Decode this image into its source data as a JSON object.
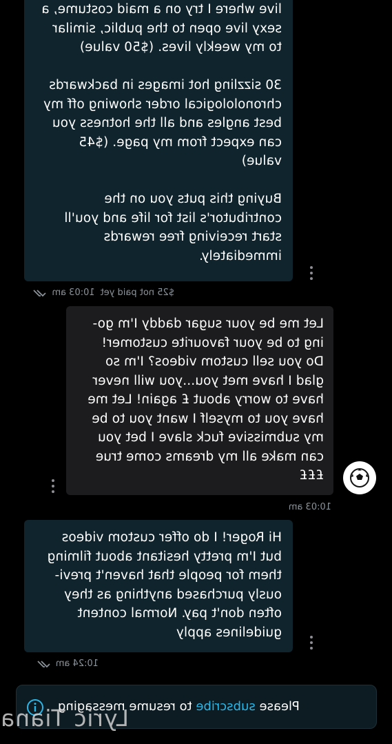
{
  "messages": [
    {
      "paragraphs": [
        "live where I try on a maid costume, a\nsexy live open to the public, similar\nto my weekly lives. ($50 value)",
        "30 sizzling hot images in backwards\nchronolological order showing off my\nbest angles and all the hotness you\ncan expect from my page. ($45\nvalue)",
        "Buying this puts you on the\ncontributor's list for life and you'll\nstart receiving free rewards\nimmediately."
      ],
      "status": "$25 not paid yet",
      "time": "10:03 am"
    },
    {
      "paragraphs": [
        "Let me be your sugar daddy I'm go-\ning to be your favourite customer!\nDo you sell custom videos? I'm so\nglad I have met you...you will never\nhave to worry about £ again! Let me\nhave you to myself I want you to be\nmy submissive fuck slave I bet you\ncan make all my dreams come true\n£££"
      ],
      "time": "10:03 am",
      "avatar_icon": "soccer-ball-icon"
    },
    {
      "paragraphs": [
        "Hi Roger! I do offer custom videos\nbut I'm pretty hesitant about filming\nthem for people that haven't previ-\nously purchased anything as they\noften don't pay. Normal content\nguidelines apply"
      ],
      "time": "10:24 am"
    }
  ],
  "notice": {
    "before": "Please ",
    "link": "subscribe",
    "after": " to resume messaging"
  },
  "watermark": "Lyric Tiana",
  "colors": {
    "own_bubble": "#10242d",
    "other_bubble": "#1c1c1e",
    "link": "#2ab7ea",
    "meta": "#8b939b"
  }
}
